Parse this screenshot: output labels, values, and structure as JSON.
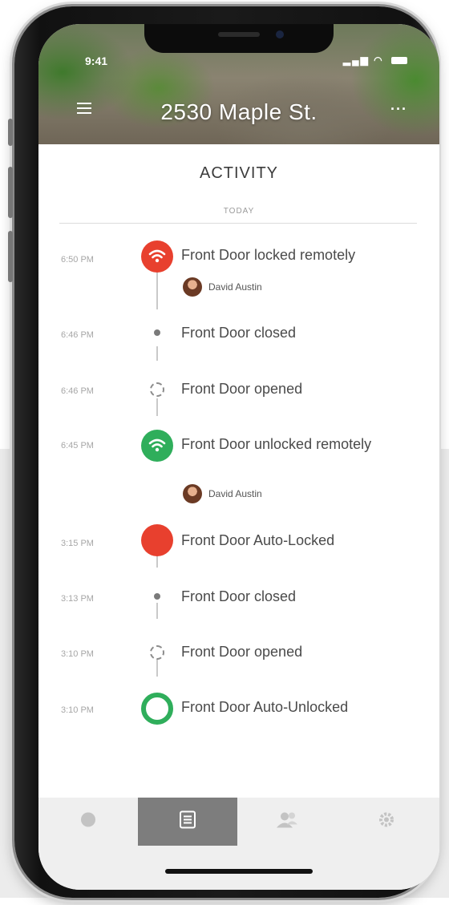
{
  "status_bar": {
    "time": "9:41"
  },
  "header": {
    "title": "2530 Maple St."
  },
  "page": {
    "heading": "ACTIVITY",
    "section": "TODAY"
  },
  "events": [
    {
      "time": "6:50 PM",
      "text": "Front Door locked remotely",
      "icon": "wifi-icon",
      "user": "David Austin"
    },
    {
      "time": "6:46 PM",
      "text": "Front Door closed",
      "icon": "dot-icon"
    },
    {
      "time": "6:46 PM",
      "text": "Front Door opened",
      "icon": "dashed-circle-icon"
    },
    {
      "time": "6:45 PM",
      "text": "Front Door unlocked remotely",
      "icon": "wifi-icon",
      "user": "David Austin"
    },
    {
      "time": "3:15 PM",
      "text": "Front Door Auto-Locked",
      "icon": "solid-circle-icon"
    },
    {
      "time": "3:13 PM",
      "text": "Front Door closed",
      "icon": "dot-icon"
    },
    {
      "time": "3:10 PM",
      "text": "Front Door opened",
      "icon": "dashed-circle-icon"
    },
    {
      "time": "3:10 PM",
      "text": "Front Door Auto-Unlocked",
      "icon": "ring-icon"
    }
  ],
  "tabs": [
    {
      "name": "lock-status-tab",
      "icon": "lock-dot-icon"
    },
    {
      "name": "activity-tab",
      "icon": "list-icon",
      "active": true
    },
    {
      "name": "users-tab",
      "icon": "users-icon"
    },
    {
      "name": "settings-tab",
      "icon": "gear-icon"
    }
  ],
  "colors": {
    "locked": "#e8402e",
    "unlocked": "#2fae5b",
    "auto_unlocked_ring": "#2fae5b",
    "active_tab": "#7d7d7d"
  }
}
